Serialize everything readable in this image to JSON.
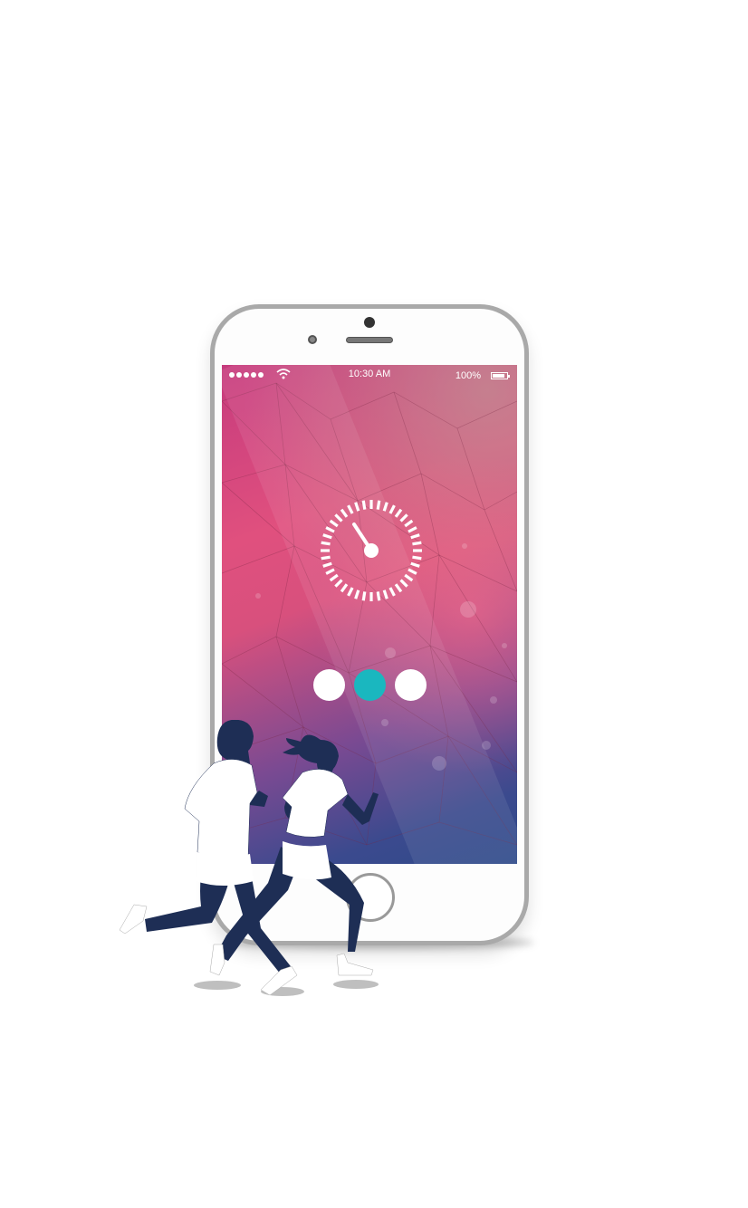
{
  "status_bar": {
    "time": "10:30 AM",
    "battery_percent": "100%",
    "battery_level": 0.85,
    "signal_dots": 5
  },
  "stopwatch": {
    "icon": "stopwatch-icon"
  },
  "pager": {
    "page_count": 3,
    "active_index": 1,
    "colors": {
      "active": "#1ab7bf",
      "inactive": "#ffffff"
    }
  },
  "colors": {
    "screen_top": "#c63b7d",
    "screen_bottom": "#2f4b8a",
    "runner": "#1e2e55"
  }
}
